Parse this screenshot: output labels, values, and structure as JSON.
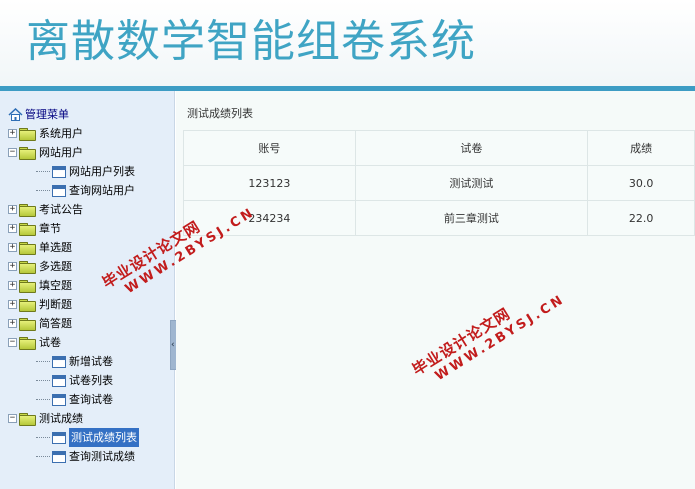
{
  "app": {
    "title": "离散数学智能组卷系统"
  },
  "sidebar": {
    "root_label": "管理菜单",
    "items": [
      {
        "label": "系统用户"
      },
      {
        "label": "网站用户",
        "children": [
          "网站用户列表",
          "查询网站用户"
        ]
      },
      {
        "label": "考试公告"
      },
      {
        "label": "章节"
      },
      {
        "label": "单选题"
      },
      {
        "label": "多选题"
      },
      {
        "label": "填空题"
      },
      {
        "label": "判断题"
      },
      {
        "label": "简答题"
      },
      {
        "label": "试卷",
        "children": [
          "新增试卷",
          "试卷列表",
          "查询试卷"
        ]
      },
      {
        "label": "测试成绩",
        "children": [
          "测试成绩列表",
          "查询测试成绩"
        ]
      }
    ],
    "selected": "测试成绩列表"
  },
  "main": {
    "panel_title": "测试成绩列表",
    "table": {
      "headers": [
        "账号",
        "试卷",
        "成绩"
      ],
      "rows": [
        [
          "123123",
          "测试测试",
          "30.0"
        ],
        [
          "234234",
          "前三章测试",
          "22.0"
        ]
      ]
    }
  },
  "watermark": {
    "line1": "毕业设计论文网",
    "line2": "WWW.2BYSJ.CN"
  },
  "colors": {
    "title": "#3fa4c4",
    "header_bar": "#3d9cc4",
    "sidebar_bg": "#e4eef9",
    "selected_bg": "#3470c4",
    "watermark": "#c21c1c"
  }
}
